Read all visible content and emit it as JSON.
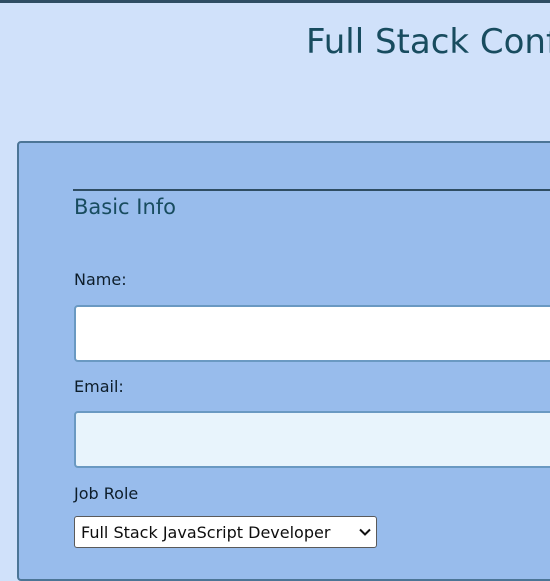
{
  "header": {
    "title": "Full Stack Conf"
  },
  "form": {
    "section_legend": "Basic Info",
    "name": {
      "label": "Name:",
      "value": ""
    },
    "email": {
      "label": "Email:",
      "value": ""
    },
    "job_role": {
      "label": "Job Role",
      "selected": "Full Stack JavaScript Developer"
    }
  },
  "icons": {
    "dropdown": "chevron-down-icon"
  },
  "colors": {
    "page_background": "#d0e1fa",
    "panel_background": "#98bcec",
    "title_text": "#184c5f",
    "input_border": "#6a99c2",
    "focused_input_background": "#e8f4fc"
  }
}
